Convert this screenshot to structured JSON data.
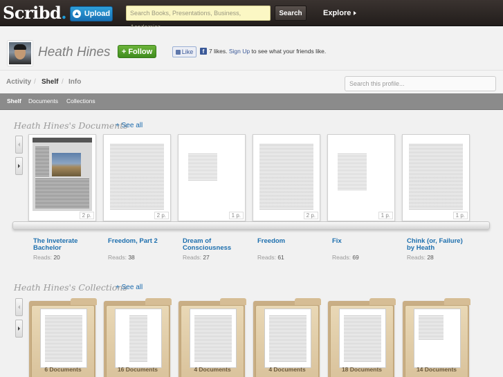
{
  "topbar": {
    "logo": "Scribd",
    "logo_dot": ".",
    "upload_label": "Upload",
    "search_placeholder": "Search Books, Presentations, Business, Academics...",
    "search_button": "Search",
    "explore_label": "Explore"
  },
  "profile": {
    "name": "Heath Hines",
    "follow_label": "+ Follow",
    "like_label": "Like",
    "fb_likes": "7 likes.",
    "fb_signup": "Sign Up",
    "fb_tail": "to see what your friends like."
  },
  "tabs": {
    "items": [
      "Activity",
      "Shelf",
      "Info"
    ],
    "active": "Shelf",
    "search_placeholder": "Search this profile..."
  },
  "subnav": {
    "items": [
      "Shelf",
      "Documents",
      "Collections"
    ]
  },
  "documents_section": {
    "title": "Heath Hines's Documents",
    "see_all": "+ See all",
    "reads_label": "Reads:",
    "items": [
      {
        "title": "The Inveterate Bachelor",
        "reads": "20",
        "pages": "2 p."
      },
      {
        "title": "Freedom, Part 2",
        "reads": "38",
        "pages": "2 p."
      },
      {
        "title": "Dream of Consciousness",
        "reads": "27",
        "pages": "1 p."
      },
      {
        "title": "Freedom",
        "reads": "61",
        "pages": "2 p."
      },
      {
        "title": "Fix",
        "reads": "69",
        "pages": "1 p."
      },
      {
        "title": "Chink (or, Failure) by Heath",
        "reads": "28",
        "pages": "1 p."
      }
    ]
  },
  "collections_section": {
    "title": "Heath Hines's Collections",
    "see_all": "+ See all",
    "items": [
      {
        "count": "6 Documents"
      },
      {
        "count": "16 Documents"
      },
      {
        "count": "4 Documents"
      },
      {
        "count": "4 Documents"
      },
      {
        "count": "18 Documents"
      },
      {
        "count": "14 Documents"
      }
    ]
  },
  "colors": {
    "link_blue": "#1d6fae",
    "follow_green": "#4f9e29",
    "upload_blue": "#1e88c8",
    "topbar_dark": "#2b2523",
    "search_yellow": "#fbf7c4"
  }
}
